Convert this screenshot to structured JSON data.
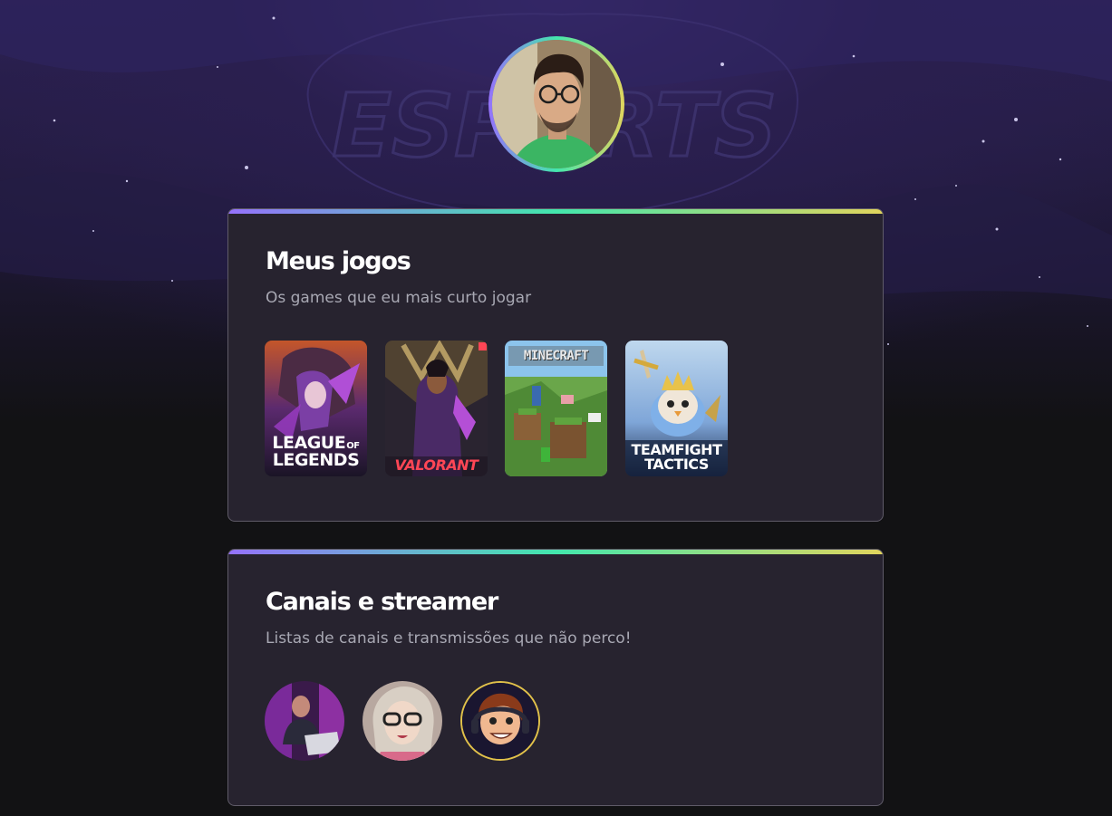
{
  "profile": {
    "avatar_alt": "profile photo",
    "background_text": "ESPORTS"
  },
  "games_section": {
    "title": "Meus jogos",
    "subtitle": "Os games que eu mais curto jogar",
    "games": [
      {
        "name": "LEAGUE OF LEGENDS",
        "line1": "LEAGUE",
        "of": "OF",
        "line2": "LEGENDS"
      },
      {
        "name": "VALORANT",
        "line1": "VALORANT"
      },
      {
        "name": "MINECRAFT",
        "line1": "MINECRAFT"
      },
      {
        "name": "TEAMFIGHT TACTICS",
        "line1": "TEAMFIGHT",
        "line2": "TACTICS"
      }
    ]
  },
  "channels_section": {
    "title": "Canais e streamer",
    "subtitle": "Listas de canais e transmissões que não perco!",
    "channels": [
      {
        "icon": "streamer-avatar-1"
      },
      {
        "icon": "streamer-avatar-2"
      },
      {
        "icon": "streamer-avatar-3"
      }
    ]
  },
  "colors": {
    "gradient_start": "#9572fc",
    "gradient_mid": "#43e7ad",
    "gradient_end": "#e1d55d",
    "card_bg": "#27232f",
    "page_bg": "#121214"
  }
}
